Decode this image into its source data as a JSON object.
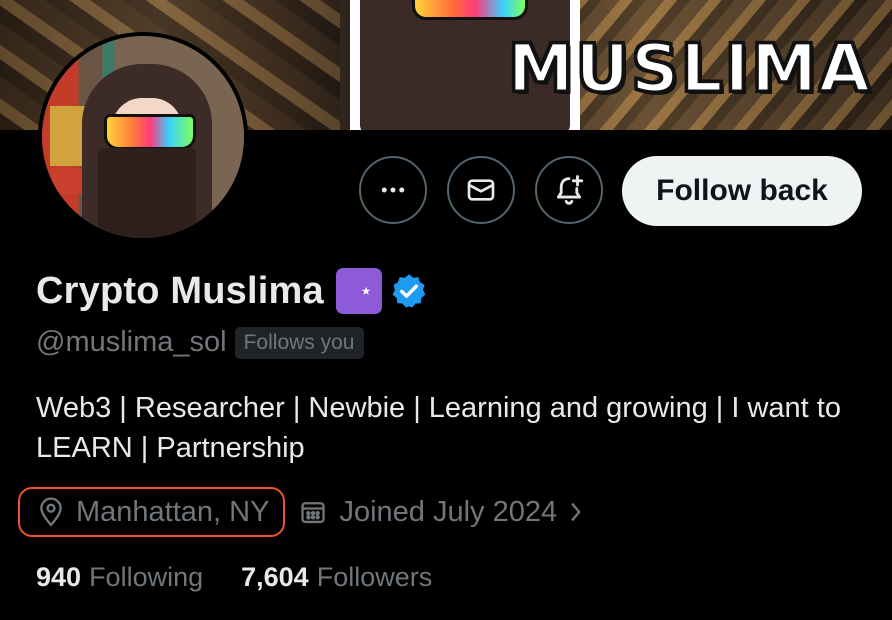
{
  "banner": {
    "brand_text": "MUSLIMA"
  },
  "actions": {
    "more_icon": "more-horizontal-icon",
    "message_icon": "envelope-icon",
    "notify_icon": "bell-plus-icon",
    "follow_label": "Follow back"
  },
  "profile": {
    "display_name": "Crypto Muslima",
    "emoji": "☪",
    "handle": "@muslima_sol",
    "follows_you": "Follows you",
    "bio": "Web3 | Researcher | Newbie | Learning and growing | I want to LEARN | Partnership",
    "location": "Manhattan, NY",
    "joined": "Joined July 2024"
  },
  "stats": {
    "following_count": "940",
    "following_label": "Following",
    "followers_count": "7,604",
    "followers_label": "Followers"
  },
  "colors": {
    "verified": "#1d9bf0",
    "highlight_outline": "#e4572e",
    "follow_button_bg": "#eff3f4",
    "muted_text": "#71767b",
    "emoji_bg": "#8d5bd8"
  }
}
